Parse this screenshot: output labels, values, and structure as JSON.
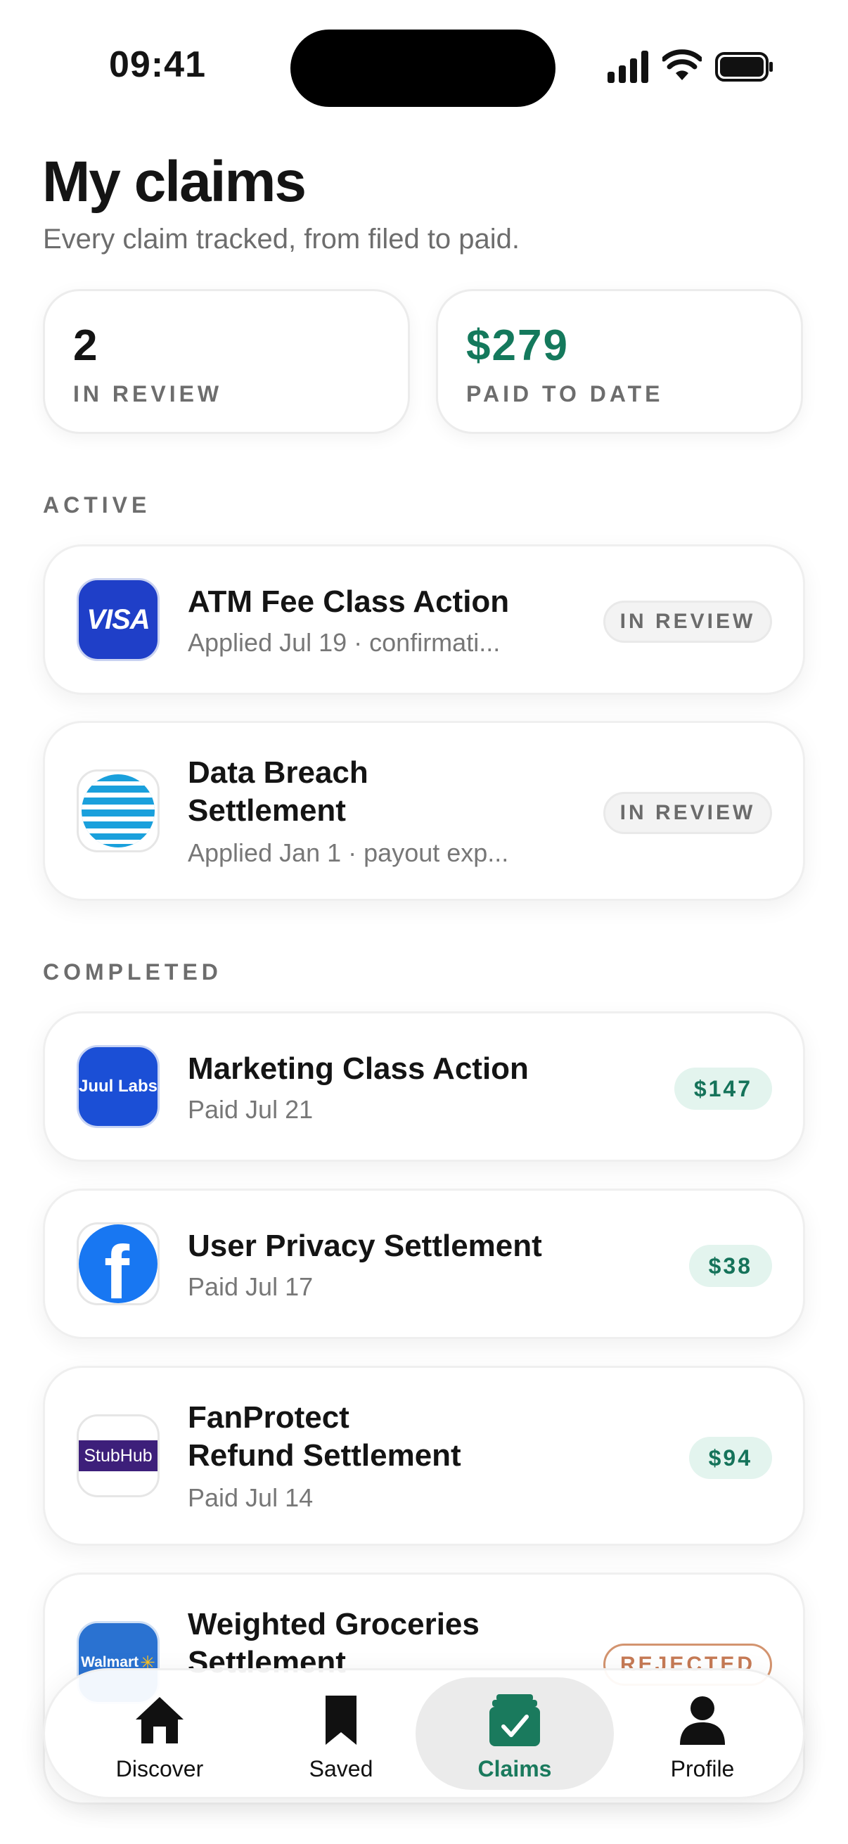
{
  "status_bar": {
    "time": "09:41"
  },
  "header": {
    "title": "My claims",
    "subtitle": "Every claim tracked, from filed to paid."
  },
  "stats": [
    {
      "value": "2",
      "label": "IN REVIEW"
    },
    {
      "value": "$279",
      "label": "PAID TO DATE",
      "value_color": "#14795c"
    }
  ],
  "sections": {
    "active": "ACTIVE",
    "completed": "COMPLETED"
  },
  "active_claims": [
    {
      "logo": "visa-logo",
      "logo_text": "VISA",
      "title": "ATM Fee Class Action",
      "subtitle": "Applied Jul 19 · confirmati...",
      "status": "IN REVIEW"
    },
    {
      "logo": "att-logo",
      "title": "Data Breach\nSettlement",
      "subtitle": "Applied Jan 1 · payout exp...",
      "status": "IN REVIEW"
    }
  ],
  "completed_claims": [
    {
      "logo": "juul-logo",
      "logo_text": "Juul Labs",
      "title": "Marketing Class Action",
      "subtitle": "Paid Jul 21",
      "amount": "$147"
    },
    {
      "logo": "facebook-logo",
      "logo_text": "f",
      "title": "User Privacy Settlement",
      "subtitle": "Paid Jul 17",
      "amount": "$38"
    },
    {
      "logo": "stubhub-logo",
      "logo_text": "StubHub",
      "title": "FanProtect\nRefund Settlement",
      "subtitle": "Paid Jul 14",
      "amount": "$94"
    },
    {
      "logo": "walmart-logo",
      "logo_text": "Walmart",
      "title": "Weighted Groceries\nSettlement",
      "subtitle": "",
      "status": "REJECTED"
    }
  ],
  "tabs": [
    {
      "label": "Discover",
      "icon": "home-icon"
    },
    {
      "label": "Saved",
      "icon": "bookmark-icon"
    },
    {
      "label": "Claims",
      "icon": "claims-check-icon",
      "active": true
    },
    {
      "label": "Profile",
      "icon": "person-icon"
    }
  ],
  "colors": {
    "accent": "#1a7a5d",
    "money_pill_bg": "#e3f4ee",
    "rejected": "#c67a55",
    "visa_blue": "#1f3fc8",
    "juul_blue": "#1b4fd6",
    "facebook_blue": "#1877f2",
    "stubhub_purple": "#3d1f7a",
    "walmart_blue": "#2a72d1"
  }
}
